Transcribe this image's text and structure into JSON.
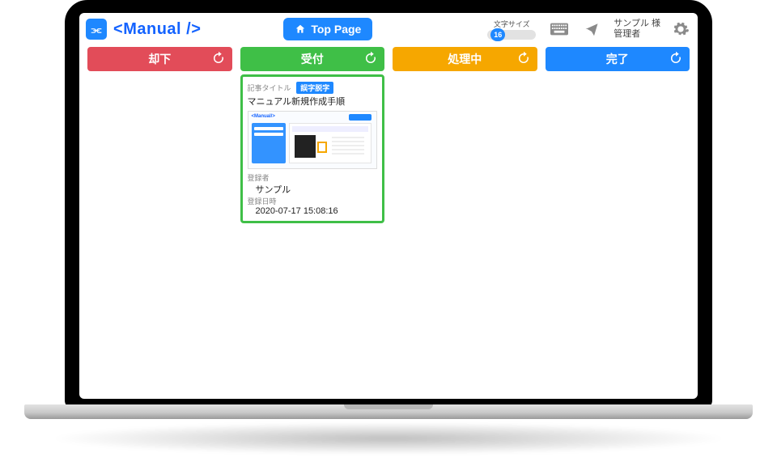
{
  "header": {
    "logo_glyph": "⫘",
    "logo_text_open": "<",
    "logo_text_word": "Manual",
    "logo_text_slash": " /",
    "logo_text_close": ">",
    "top_page_label": "Top Page",
    "font_size_label": "文字サイズ",
    "font_size_value": "16",
    "user_name": "サンプル 様",
    "user_role": "管理者"
  },
  "columns": [
    {
      "title": "却下",
      "color": "c-red"
    },
    {
      "title": "受付",
      "color": "c-green"
    },
    {
      "title": "処理中",
      "color": "c-orange"
    },
    {
      "title": "完了",
      "color": "c-blue"
    }
  ],
  "card": {
    "title_label": "記事タイトル",
    "badge": "誤字脱字",
    "title": "マニュアル新規作成手順",
    "thumb_brand": "<Manual/>",
    "registrant_label": "登録者",
    "registrant": "サンプル",
    "datetime_label": "登録日時",
    "datetime": "2020-07-17 15:08:16"
  }
}
